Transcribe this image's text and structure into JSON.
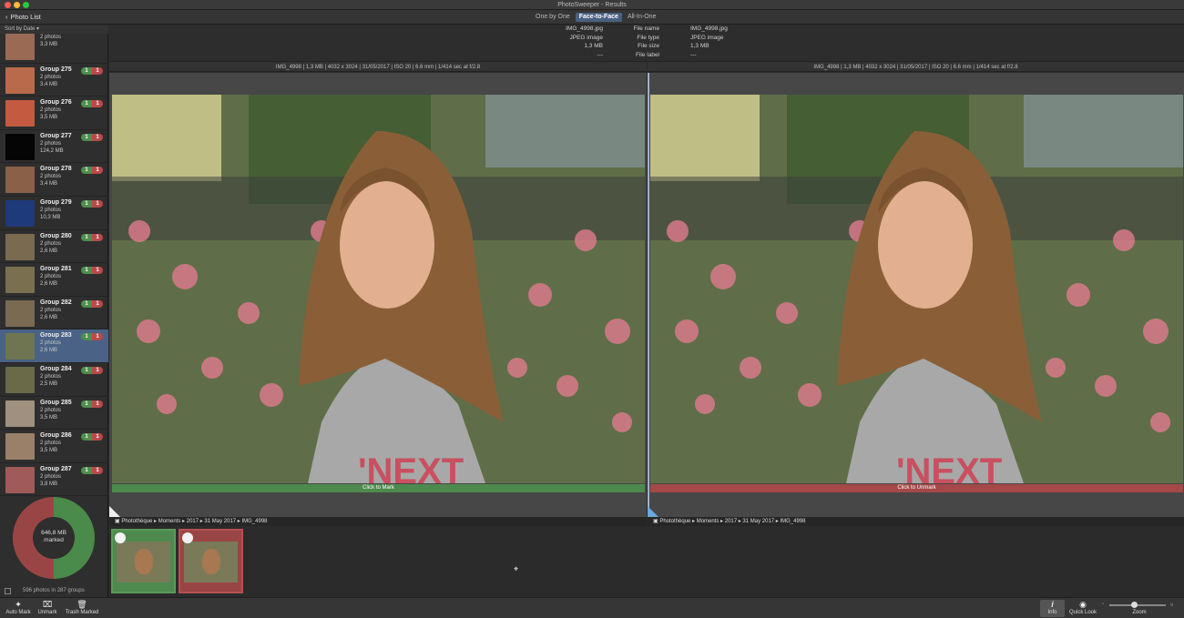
{
  "window": {
    "title": "PhotoSweeper - Results"
  },
  "toolbar": {
    "back_label": "Photo List",
    "modes": [
      "One by One",
      "Face-to-Face",
      "All-In-One"
    ],
    "active_mode": "Face-to-Face"
  },
  "sidebar": {
    "sort_label": "Sort by Date",
    "groups": [
      {
        "name": "",
        "photos": "2 photos",
        "size": "3,3 MB",
        "green": "",
        "red": "",
        "thumb": "#9a6a55"
      },
      {
        "name": "Group 275",
        "photos": "2 photos",
        "size": "3,4 MB",
        "green": "1",
        "red": "1",
        "thumb": "#b86a4a"
      },
      {
        "name": "Group 276",
        "photos": "2 photos",
        "size": "3,5 MB",
        "green": "1",
        "red": "1",
        "thumb": "#c45a40"
      },
      {
        "name": "Group 277",
        "photos": "2 photos",
        "size": "124,2 MB",
        "green": "1",
        "red": "1",
        "thumb": "#050505"
      },
      {
        "name": "Group 278",
        "photos": "2 photos",
        "size": "3,4 MB",
        "green": "1",
        "red": "1",
        "thumb": "#8a6048"
      },
      {
        "name": "Group 279",
        "photos": "2 photos",
        "size": "10,3 MB",
        "green": "1",
        "red": "1",
        "thumb": "#1e3a7a"
      },
      {
        "name": "Group 280",
        "photos": "2 photos",
        "size": "2,6 MB",
        "green": "1",
        "red": "1",
        "thumb": "#7a6a50"
      },
      {
        "name": "Group 281",
        "photos": "2 photos",
        "size": "2,6 MB",
        "green": "1",
        "red": "1",
        "thumb": "#7a7050"
      },
      {
        "name": "Group 282",
        "photos": "2 photos",
        "size": "2,6 MB",
        "green": "1",
        "red": "1",
        "thumb": "#7a6a52"
      },
      {
        "name": "Group 283",
        "photos": "2 photos",
        "size": "2,6 MB",
        "green": "1",
        "red": "1",
        "thumb": "#6f7550"
      },
      {
        "name": "Group 284",
        "photos": "2 photos",
        "size": "2,5 MB",
        "green": "1",
        "red": "1",
        "thumb": "#6a6a48"
      },
      {
        "name": "Group 285",
        "photos": "2 photos",
        "size": "3,5 MB",
        "green": "1",
        "red": "1",
        "thumb": "#a09080"
      },
      {
        "name": "Group 286",
        "photos": "2 photos",
        "size": "3,5 MB",
        "green": "1",
        "red": "1",
        "thumb": "#9a8068"
      },
      {
        "name": "Group 287",
        "photos": "2 photos",
        "size": "3,8 MB",
        "green": "1",
        "red": "1",
        "thumb": "#a05a5a"
      }
    ],
    "selected_group": "Group 283",
    "donut": {
      "size": "646,8 MB",
      "label": "marked",
      "marked_fraction": 0.5
    },
    "footer": "596 photos in 287 groups"
  },
  "info": {
    "keys": [
      "File name",
      "File type",
      "File size",
      "File label"
    ],
    "left": [
      "IMG_4998.jpg",
      "JPEG image",
      "1,3 MB",
      "---"
    ],
    "right": [
      "IMG_4998.jpg",
      "JPEG image",
      "1,3 MB",
      "---"
    ]
  },
  "meta_left": "IMG_4998 | 1,3 MB | 4032 x 3024 | 31/05/2017 | ISO 20 | 6.6 mm | 1/414 sec at f/2.8",
  "meta_right": "IMG_4998 | 1,3 MB | 4032 x 3024 | 31/05/2017 | ISO 20 | 6.6 mm | 1/414 sec at f/2.8",
  "left_pane": {
    "mark_label": "Click to Mark",
    "bar_color": "#4e8a4e"
  },
  "right_pane": {
    "mark_label": "Click to Unmark",
    "bar_color": "#a54848"
  },
  "path_left": "Photothèque ▸ Moments ▸ 2017 ▸ 31 May 2017 ▸ IMG_4998",
  "path_right": "Photothèque ▸ Moments ▸ 2017 ▸ 31 May 2017 ▸ IMG_4998",
  "bottom": {
    "auto_mark": "Auto Mark",
    "unmark": "Unmark",
    "trash_marked": "Trash Marked",
    "info": "Info",
    "quick_look": "Quick Look",
    "zoom": "Zoom"
  }
}
